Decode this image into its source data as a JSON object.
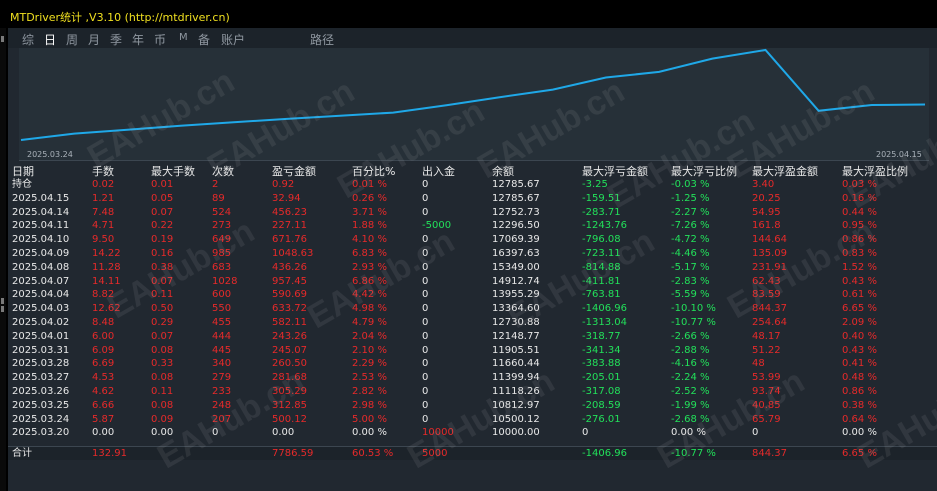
{
  "window": {
    "title": "MTDriver统计 ,V3.10 (http://mtdriver.cn)"
  },
  "tabs": [
    {
      "label": "综",
      "active": false
    },
    {
      "label": "日",
      "active": true
    },
    {
      "label": "周",
      "active": false
    },
    {
      "label": "月",
      "active": false
    },
    {
      "label": "季",
      "active": false
    },
    {
      "label": "年",
      "active": false
    },
    {
      "label": "币",
      "active": false
    },
    {
      "label": "M",
      "active": false
    },
    {
      "label": "备",
      "active": false
    },
    {
      "label": "账户",
      "active": false
    },
    {
      "label": "路径",
      "active": false
    }
  ],
  "chart_data": {
    "type": "line",
    "x_start_label": "2025.03.24",
    "x_end_label": "2025.04.15",
    "x": [
      "2025.03.20",
      "2025.03.24",
      "2025.03.25",
      "2025.03.26",
      "2025.03.27",
      "2025.03.28",
      "2025.03.31",
      "2025.04.01",
      "2025.04.02",
      "2025.04.03",
      "2025.04.04",
      "2025.04.07",
      "2025.04.08",
      "2025.04.09",
      "2025.04.10",
      "2025.04.11",
      "2025.04.14",
      "2025.04.15"
    ],
    "series": [
      {
        "values": [
          10000.0,
          10500.12,
          10812.97,
          11118.26,
          11399.94,
          11660.44,
          11905.51,
          12148.77,
          12730.88,
          13364.6,
          13955.29,
          14912.74,
          15349.0,
          16397.63,
          17069.39,
          12296.5,
          12752.73,
          12785.67
        ]
      }
    ],
    "line_color": "#1fa8e8"
  },
  "table": {
    "headers": [
      "日期",
      "手数",
      "最大手数",
      "次数",
      "盈亏金额",
      "百分比%",
      "出入金",
      "余额",
      "最大浮亏金额",
      "最大浮亏比例",
      "最大浮盈金额",
      "最大浮盈比例"
    ],
    "rows": [
      [
        "持仓",
        "0.02",
        "0.01",
        "2",
        "0.92",
        "0.01 %",
        "0",
        "12785.67",
        "-3.25",
        "-0.03 %",
        "3.40",
        "0.03 %"
      ],
      [
        "2025.04.15",
        "1.21",
        "0.05",
        "89",
        "32.94",
        "0.26 %",
        "0",
        "12785.67",
        "-159.51",
        "-1.25 %",
        "20.25",
        "0.16 %"
      ],
      [
        "2025.04.14",
        "7.48",
        "0.07",
        "524",
        "456.23",
        "3.71 %",
        "0",
        "12752.73",
        "-283.71",
        "-2.27 %",
        "54.95",
        "0.44 %"
      ],
      [
        "2025.04.11",
        "4.71",
        "0.22",
        "273",
        "227.11",
        "1.88 %",
        "-5000",
        "12296.50",
        "-1243.76",
        "-7.26 %",
        "161.8",
        "0.95 %"
      ],
      [
        "2025.04.10",
        "9.50",
        "0.19",
        "649",
        "671.76",
        "4.10 %",
        "0",
        "17069.39",
        "-796.08",
        "-4.72 %",
        "144.64",
        "0.86 %"
      ],
      [
        "2025.04.09",
        "14.22",
        "0.16",
        "985",
        "1048.63",
        "6.83 %",
        "0",
        "16397.63",
        "-723.11",
        "-4.46 %",
        "135.09",
        "0.83 %"
      ],
      [
        "2025.04.08",
        "11.28",
        "0.38",
        "683",
        "436.26",
        "2.93 %",
        "0",
        "15349.00",
        "-814.88",
        "-5.17 %",
        "231.91",
        "1.52 %"
      ],
      [
        "2025.04.07",
        "14.11",
        "0.07",
        "1028",
        "957.45",
        "6.86 %",
        "0",
        "14912.74",
        "-411.81",
        "-2.83 %",
        "62.43",
        "0.43 %"
      ],
      [
        "2025.04.04",
        "8.82",
        "0.11",
        "600",
        "590.69",
        "4.42 %",
        "0",
        "13955.29",
        "-763.81",
        "-5.59 %",
        "83.59",
        "0.61 %"
      ],
      [
        "2025.04.03",
        "12.62",
        "0.50",
        "550",
        "633.72",
        "4.98 %",
        "0",
        "13364.60",
        "-1406.96",
        "-10.10 %",
        "844.37",
        "6.65 %"
      ],
      [
        "2025.04.02",
        "8.48",
        "0.29",
        "455",
        "582.11",
        "4.79 %",
        "0",
        "12730.88",
        "-1313.04",
        "-10.77 %",
        "254.64",
        "2.09 %"
      ],
      [
        "2025.04.01",
        "6.00",
        "0.07",
        "444",
        "243.26",
        "2.04 %",
        "0",
        "12148.77",
        "-318.77",
        "-2.66 %",
        "48.17",
        "0.40 %"
      ],
      [
        "2025.03.31",
        "6.09",
        "0.08",
        "445",
        "245.07",
        "2.10 %",
        "0",
        "11905.51",
        "-341.34",
        "-2.88 %",
        "51.22",
        "0.43 %"
      ],
      [
        "2025.03.28",
        "6.69",
        "0.33",
        "340",
        "260.50",
        "2.29 %",
        "0",
        "11660.44",
        "-383.88",
        "-4.16 %",
        "48",
        "0.41 %"
      ],
      [
        "2025.03.27",
        "4.53",
        "0.08",
        "279",
        "281.68",
        "2.53 %",
        "0",
        "11399.94",
        "-205.01",
        "-2.24 %",
        "53.99",
        "0.48 %"
      ],
      [
        "2025.03.26",
        "4.62",
        "0.11",
        "233",
        "305.29",
        "2.82 %",
        "0",
        "11118.26",
        "-317.08",
        "-2.52 %",
        "93.74",
        "0.86 %"
      ],
      [
        "2025.03.25",
        "6.66",
        "0.08",
        "248",
        "312.85",
        "2.98 %",
        "0",
        "10812.97",
        "-208.59",
        "-1.99 %",
        "40.85",
        "0.38 %"
      ],
      [
        "2025.03.24",
        "5.87",
        "0.09",
        "207",
        "500.12",
        "5.00 %",
        "0",
        "10500.12",
        "-276.01",
        "-2.68 %",
        "65.79",
        "0.64 %"
      ],
      [
        "2025.03.20",
        "0.00",
        "0.00",
        "0",
        "0.00",
        "0.00 %",
        "10000",
        "10000.00",
        "0",
        "0.00 %",
        "0",
        "0.00 %"
      ]
    ],
    "total": [
      "合计",
      "132.91",
      "",
      "",
      "7786.59",
      "60.53 %",
      "5000",
      "",
      "-1406.96",
      "-10.77 %",
      "844.37",
      "6.65 %"
    ]
  },
  "watermark": "EAHub.cn",
  "colors": {
    "positive": "#e62a2a",
    "negative": "#22e05a",
    "neutral": "#e8e8e8",
    "title": "#f0e020"
  }
}
